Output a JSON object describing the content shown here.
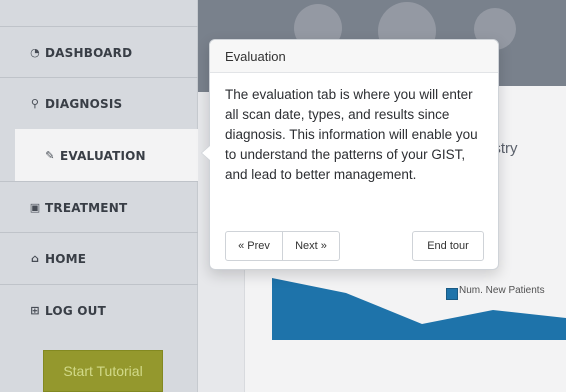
{
  "sidebar": {
    "items": [
      {
        "label": "DASHBOARD",
        "icon": "dashboard-icon",
        "icon_glyph": "◔"
      },
      {
        "label": "DIAGNOSIS",
        "icon": "flask-icon",
        "icon_glyph": "⚲"
      },
      {
        "label": "EVALUATION",
        "icon": "edit-icon",
        "icon_glyph": "✎"
      },
      {
        "label": "TREATMENT",
        "icon": "medkit-icon",
        "icon_glyph": "▣"
      },
      {
        "label": "HOME",
        "icon": "home-icon",
        "icon_glyph": "⌂"
      },
      {
        "label": "LOG OUT",
        "icon": "logout-icon",
        "icon_glyph": "⊞"
      }
    ],
    "active_item": "EVALUATION",
    "start_tutorial_label": "Start Tutorial"
  },
  "main": {
    "card_title_partial": "istry",
    "legend_label": "Num. New Patients"
  },
  "tour_popover": {
    "title": "Evaluation",
    "body": "The evaluation tab is where you will enter all scan date, types, and results since diagnosis. This information will enable you to understand the patterns of your GIST, and lead to better management.",
    "prev_label": "« Prev",
    "next_label": "Next »",
    "end_label": "End tour"
  },
  "colors": {
    "chart_fill": "#1f79b1",
    "start_button": "#9ba02e",
    "sidebar_bg": "#e1e4e8",
    "active_nav": "#ffffff"
  }
}
